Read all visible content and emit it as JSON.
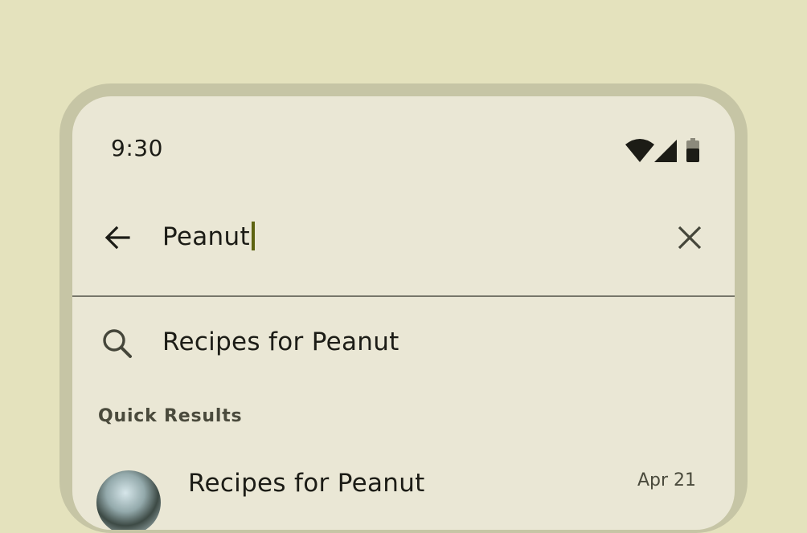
{
  "status_bar": {
    "time": "9:30",
    "icons": [
      "wifi-icon",
      "cellular-signal-icon",
      "battery-icon"
    ]
  },
  "search": {
    "query": "Peanut",
    "back_icon": "arrow-back-icon",
    "clear_icon": "close-icon"
  },
  "suggestion": {
    "icon": "search-icon",
    "text": "Recipes for Peanut"
  },
  "quick_results": {
    "header": "Quick Results",
    "items": [
      {
        "title": "Recipes for Peanut",
        "date": "Apr 21",
        "avatar": "avatar-image"
      }
    ]
  },
  "colors": {
    "background": "#e4e2bd",
    "frame": "#c6c5a5",
    "surface": "#eae7d5",
    "caret": "#5d6310",
    "divider": "#77766a"
  }
}
